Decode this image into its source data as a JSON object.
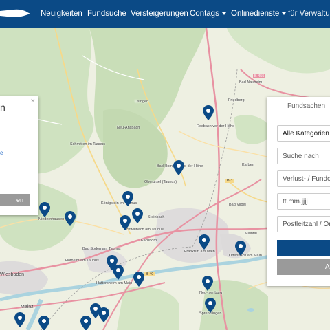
{
  "nav": {
    "items": [
      {
        "label": "Neuigkeiten",
        "dropdown": false
      },
      {
        "label": "Fundsuche",
        "dropdown": false
      },
      {
        "label": "Versteigerungen",
        "dropdown": false
      },
      {
        "label": "Contags",
        "dropdown": true
      },
      {
        "label": "Onlinedienste",
        "dropdown": true
      },
      {
        "label": "für Verwaltung",
        "dropdown": false
      }
    ],
    "background": "#0b4a86"
  },
  "map": {
    "place_labels": [
      "Usingen",
      "Neu-Anspach",
      "Schmitten im Taunus",
      "Bad Homburg vor der Höhe",
      "Oberursel (Taunus)",
      "Königstein im Taunus",
      "Niedernhausen",
      "Schwalbach am Taunus",
      "Eschborn",
      "Steinbach",
      "Frankfurt am Main",
      "Offenbach am Main",
      "Bad Vilbel",
      "Bad Nauheim",
      "Friedberg",
      "Bad Soden am Taunus",
      "Hattersheim am Main",
      "Wiesbaden",
      "Mainz",
      "Neu-Isenburg",
      "Sprendlingen",
      "Hofheim am Taunus",
      "Maintal",
      "Rosbach vor der Höhe",
      "Karben"
    ],
    "road_labels": [
      "B 455",
      "B 3",
      "B 8",
      "A 5",
      "A 66",
      "B 40"
    ],
    "marker_icon": "map-marker-icon",
    "marker_color": "#0b4a86"
  },
  "left_panel": {
    "title": "n",
    "close_icon": "close-icon",
    "link": "e",
    "button_label": "en"
  },
  "search_panel": {
    "tab_label": "Fundsachen",
    "category_select": "Alle Kategorien",
    "search_placeholder": "Suche nach",
    "type_placeholder": "Verlust- / Fundort",
    "date_placeholder": "tt.mm.jjjj",
    "postcode_placeholder": "Postleitzahl / Ort",
    "secondary_button_label": "A"
  }
}
